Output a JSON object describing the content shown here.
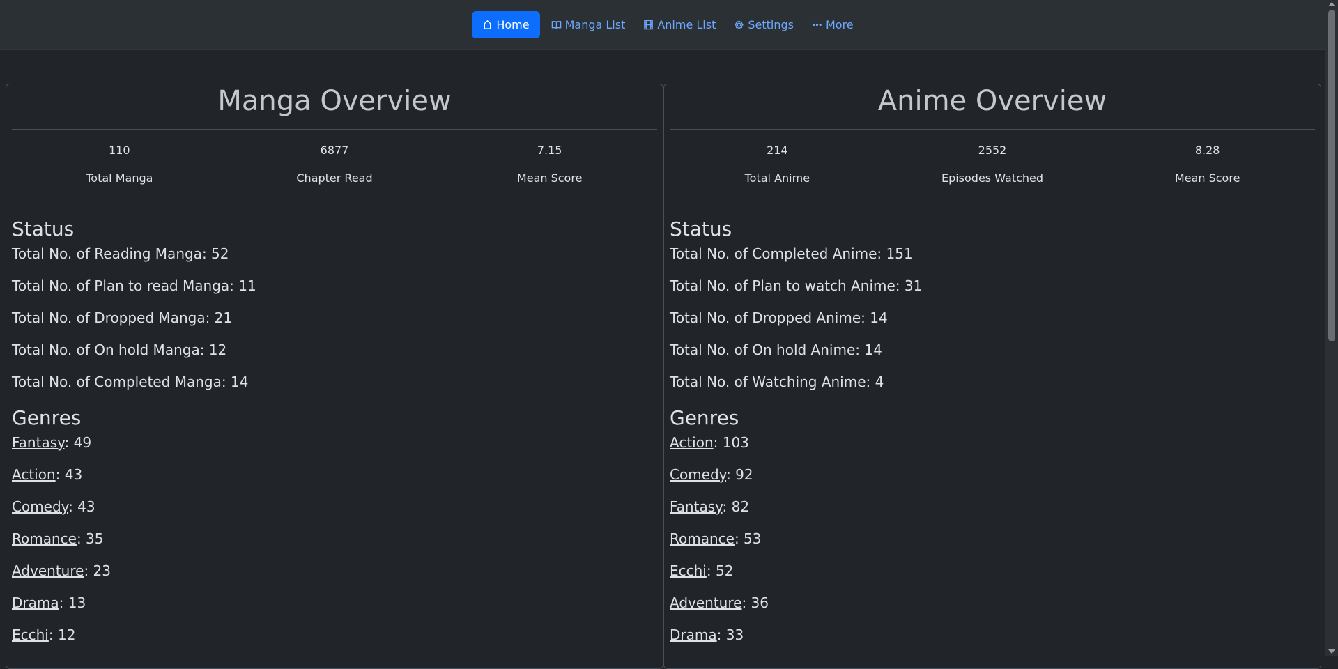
{
  "nav": {
    "items": [
      {
        "label": "Home",
        "icon": "home-icon",
        "active": true
      },
      {
        "label": "Manga List",
        "icon": "book-icon"
      },
      {
        "label": "Anime List",
        "icon": "film-icon"
      },
      {
        "label": "Settings",
        "icon": "gear-icon"
      },
      {
        "label": "More",
        "icon": "ellipsis-icon"
      }
    ]
  },
  "manga": {
    "title": "Manga Overview",
    "stats": [
      {
        "value": "110",
        "label": "Total Manga"
      },
      {
        "value": "6877",
        "label": "Chapter Read"
      },
      {
        "value": "7.15",
        "label": "Mean Score"
      }
    ],
    "status_title": "Status",
    "status": [
      "Total No. of Reading Manga: 52",
      "Total No. of Plan to read Manga: 11",
      "Total No. of Dropped Manga: 21",
      "Total No. of On hold Manga: 12",
      "Total No. of Completed Manga: 14"
    ],
    "genres_title": "Genres",
    "genres": [
      {
        "name": "Fantasy",
        "count": ": 49"
      },
      {
        "name": "Action",
        "count": ": 43"
      },
      {
        "name": "Comedy",
        "count": ": 43"
      },
      {
        "name": "Romance",
        "count": ": 35"
      },
      {
        "name": "Adventure",
        "count": ": 23"
      },
      {
        "name": "Drama",
        "count": ": 13"
      },
      {
        "name": "Ecchi",
        "count": ": 12"
      }
    ]
  },
  "anime": {
    "title": "Anime Overview",
    "stats": [
      {
        "value": "214",
        "label": "Total Anime"
      },
      {
        "value": "2552",
        "label": "Episodes Watched"
      },
      {
        "value": "8.28",
        "label": "Mean Score"
      }
    ],
    "status_title": "Status",
    "status": [
      "Total No. of Completed Anime: 151",
      "Total No. of Plan to watch Anime: 31",
      "Total No. of Dropped Anime: 14",
      "Total No. of On hold Anime: 14",
      "Total No. of Watching Anime: 4"
    ],
    "genres_title": "Genres",
    "genres": [
      {
        "name": "Action",
        "count": ": 103"
      },
      {
        "name": "Comedy",
        "count": ": 92"
      },
      {
        "name": "Fantasy",
        "count": ": 82"
      },
      {
        "name": "Romance",
        "count": ": 53"
      },
      {
        "name": "Ecchi",
        "count": ": 52"
      },
      {
        "name": "Adventure",
        "count": ": 36"
      },
      {
        "name": "Drama",
        "count": ": 33"
      }
    ]
  },
  "colors": {
    "background": "#212529",
    "navbar": "#2b3035",
    "accent": "#0d6efd",
    "link": "#6ea8fe"
  }
}
